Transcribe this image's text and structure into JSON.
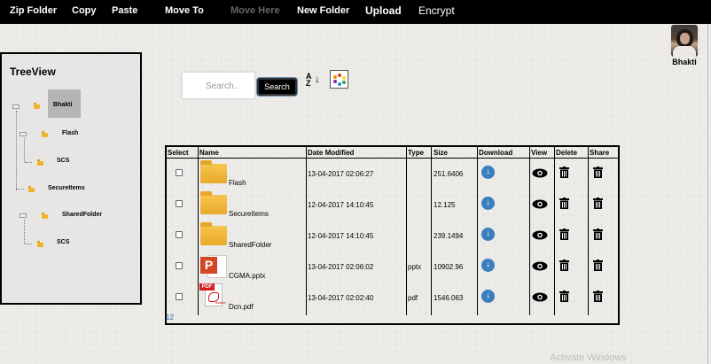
{
  "topbar": {
    "zip_folder": "Zip Folder",
    "copy": "Copy",
    "paste": "Paste",
    "move_to": "Move To",
    "move_here": "Move Here",
    "new_folder": "New Folder",
    "upload": "Upload",
    "encrypt": "Encrypt"
  },
  "user": {
    "name": "Bhakti"
  },
  "treeview": {
    "title": "TreeView",
    "nodes": [
      "Bhakti",
      "Flash",
      "SCS",
      "SecureItems",
      "SharedFolder",
      "SCS"
    ]
  },
  "search": {
    "placeholder": "Search..",
    "button_label": "Search"
  },
  "sort": {
    "label": "AZ"
  },
  "table": {
    "headers": [
      "Select",
      "Name",
      "Date Modified",
      "Type",
      "Size",
      "Download",
      "View",
      "Delete",
      "Share"
    ],
    "rows": [
      {
        "name": "Flash",
        "date": "13-04-2017 02:06:27",
        "type": "",
        "size": "251.6406",
        "icon": "folder-icon"
      },
      {
        "name": "SecureItems",
        "date": "12-04-2017 14:10:45",
        "type": "",
        "size": "12.125",
        "icon": "folder-icon"
      },
      {
        "name": "SharedFolder",
        "date": "12-04-2017 14:10:45",
        "type": "",
        "size": "239.1494",
        "icon": "folder-icon"
      },
      {
        "name": "CGMA.pptx",
        "date": "13-04-2017 02:06:02",
        "type": "pptx",
        "size": "10902.96",
        "icon": "pptx-file-icon"
      },
      {
        "name": "Dcn.pdf",
        "date": "13-04-2017 02:02:40",
        "type": "pdf",
        "size": "1546.063",
        "icon": "pdf-file-icon"
      }
    ],
    "pager": "12"
  },
  "watermark": "Activate Windows",
  "colors": {
    "topbar": "#000000",
    "download": "#3a7ebf",
    "folder": "#f0b429",
    "pager_link": "#1a5fb4"
  }
}
